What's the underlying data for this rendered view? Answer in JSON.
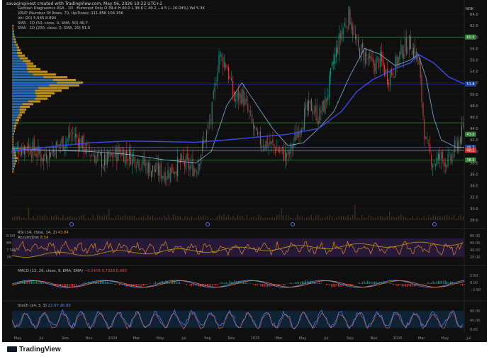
{
  "header": {
    "created_by": "savagingivest created with TradingView.com, May 06, 2026 10:22 UTC+2"
  },
  "legend": [
    {
      "label": "Gentian Diagnostics ASA · 1D · Euronext Oslo",
      "values": "O 39.4 H 40.0 L 38.6 C 40.2 −4.5 (−10.04%) Vol 5.3K"
    },
    {
      "label": "VRVP (Number Of Rows, 70, Up/Down)",
      "values": "111.85K 104.15K"
    },
    {
      "label": "Vol (20)",
      "values": "5.545 8.894"
    },
    {
      "label": "SMA · 1D (50, close, 0, SMA, 50)",
      "values": "40.7"
    },
    {
      "label": "SMA · 1D (200, close, 0, SMA, 20)",
      "values": "51.5"
    }
  ],
  "currency_label": "NOK",
  "price_badges": [
    {
      "text": "60.0",
      "color": "#2e7d32"
    },
    {
      "text": "51.8",
      "color": "#1e3fa3"
    },
    {
      "text": "43.0",
      "color": "#2e7d32"
    },
    {
      "text": "40.7",
      "color": "#1e3fa3"
    },
    {
      "text": "40.2",
      "color": "#d32f2f"
    },
    {
      "text": "38.5",
      "color": "#2e7d32"
    }
  ],
  "rsi_panel": {
    "legend": "RSI (14, close, 14, 2)",
    "legend_value": "43.84",
    "legend2": "Accum/Dist",
    "legend2_value": "8.54",
    "left_scale": [
      "8.5M",
      "8M",
      "7.5M",
      "7M"
    ],
    "right_scale": [
      "80.00",
      "60.00",
      "40.00",
      "20.00"
    ]
  },
  "macd_panel": {
    "legend": "MACD (12, 26, close, 9, EMA, EMA)",
    "legend_values": "−0.1478 0.7328 0.880",
    "right_scale": [
      "2.50",
      "0.00",
      "−2.50"
    ]
  },
  "stoch_panel": {
    "legend": "Stoch (14, 3, 3)",
    "legend_values": "22.97 26.89",
    "right_scale": [
      "80.00",
      "40.00",
      "0.00"
    ]
  },
  "branding": {
    "logo_text": "TradingView"
  },
  "chart_data": {
    "type": "candlestick",
    "x_ticks": [
      "May",
      "Jul",
      "Sep",
      "Nov",
      "2024",
      "Mar",
      "May",
      "Jul",
      "Sep",
      "Nov",
      "2025",
      "Mar",
      "May",
      "Jul",
      "Sep",
      "Nov",
      "2026",
      "Mar",
      "May",
      "Jul"
    ],
    "y_ticks": [
      64.0,
      62.0,
      60.0,
      58.0,
      56.0,
      54.0,
      52.0,
      50.0,
      48.0,
      46.0,
      44.0,
      42.0,
      40.0,
      38.0,
      36.0,
      34.0,
      32.0,
      30.0,
      28.0
    ],
    "ylim": [
      27,
      65
    ],
    "horizontal_levels": [
      {
        "value": 60.0,
        "color": "#2e7d32"
      },
      {
        "value": 51.8,
        "color": "#1e3fa3"
      },
      {
        "value": 45.0,
        "color": "#2e7d32"
      },
      {
        "value": 40.7,
        "color": "#3f56c8"
      },
      {
        "value": 40.2,
        "color": "#888888"
      },
      {
        "value": 38.5,
        "color": "#2e7d32"
      }
    ],
    "close_path": [
      [
        0,
        40
      ],
      [
        4,
        41
      ],
      [
        8,
        39
      ],
      [
        12,
        41
      ],
      [
        16,
        43
      ],
      [
        20,
        40
      ],
      [
        24,
        38
      ],
      [
        28,
        40
      ],
      [
        32,
        39
      ],
      [
        36,
        37
      ],
      [
        40,
        36
      ],
      [
        44,
        38
      ],
      [
        48,
        37
      ],
      [
        52,
        46
      ],
      [
        54,
        57
      ],
      [
        56,
        55
      ],
      [
        58,
        49
      ],
      [
        60,
        50
      ],
      [
        62,
        46
      ],
      [
        64,
        42
      ],
      [
        68,
        41
      ],
      [
        72,
        39
      ],
      [
        76,
        46
      ],
      [
        78,
        48
      ],
      [
        80,
        46
      ],
      [
        82,
        49
      ],
      [
        84,
        56
      ],
      [
        86,
        61
      ],
      [
        88,
        64
      ],
      [
        90,
        58
      ],
      [
        92,
        57
      ],
      [
        94,
        55
      ],
      [
        96,
        56
      ],
      [
        98,
        53
      ],
      [
        100,
        55
      ],
      [
        102,
        58
      ],
      [
        104,
        59
      ],
      [
        106,
        56
      ],
      [
        108,
        41
      ],
      [
        110,
        38
      ],
      [
        112,
        39
      ],
      [
        114,
        38
      ],
      [
        116,
        41
      ],
      [
        118,
        44
      ]
    ],
    "sma50_path": [
      [
        0,
        40.5
      ],
      [
        10,
        40.2
      ],
      [
        20,
        40
      ],
      [
        30,
        39.5
      ],
      [
        40,
        38.5
      ],
      [
        48,
        38
      ],
      [
        52,
        40
      ],
      [
        56,
        48
      ],
      [
        60,
        52
      ],
      [
        64,
        48
      ],
      [
        68,
        44
      ],
      [
        72,
        41
      ],
      [
        76,
        41.5
      ],
      [
        80,
        44
      ],
      [
        84,
        47
      ],
      [
        88,
        53
      ],
      [
        92,
        58
      ],
      [
        96,
        57
      ],
      [
        100,
        55
      ],
      [
        104,
        56
      ],
      [
        106,
        57
      ],
      [
        108,
        53
      ],
      [
        110,
        46
      ],
      [
        112,
        42
      ],
      [
        116,
        40.7
      ],
      [
        118,
        40.7
      ]
    ],
    "sma200_path": [
      [
        0,
        40
      ],
      [
        10,
        40.8
      ],
      [
        20,
        41.5
      ],
      [
        30,
        41.8
      ],
      [
        40,
        41.7
      ],
      [
        48,
        41.6
      ],
      [
        56,
        42
      ],
      [
        64,
        42.5
      ],
      [
        72,
        43
      ],
      [
        80,
        44
      ],
      [
        86,
        47
      ],
      [
        90,
        50.5
      ],
      [
        94,
        52.5
      ],
      [
        100,
        54.5
      ],
      [
        104,
        55.5
      ],
      [
        106,
        57
      ],
      [
        110,
        55.5
      ],
      [
        114,
        53
      ],
      [
        118,
        51.8
      ]
    ]
  }
}
